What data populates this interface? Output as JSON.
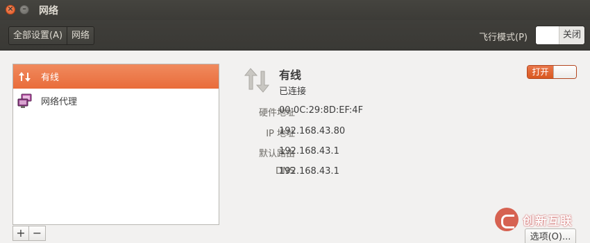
{
  "window": {
    "title": "网络"
  },
  "toolbar": {
    "breadcrumbs": [
      "全部设置(A)",
      "网络"
    ],
    "airplane_mode_label": "飞行模式(P)",
    "airplane_toggle_state": "关闭"
  },
  "sidebar": {
    "items": [
      {
        "label": "有线",
        "icon": "wired-network-icon",
        "selected": true
      },
      {
        "label": "网络代理",
        "icon": "network-proxy-icon",
        "selected": false
      }
    ],
    "add_label": "+",
    "remove_label": "−"
  },
  "detail": {
    "title": "有线",
    "status": "已连接",
    "toggle_state": "打开",
    "rows": [
      {
        "key": "硬件地址",
        "value": "00:0C:29:8D:EF:4F"
      },
      {
        "key": "IP 地址",
        "value": "192.168.43.80"
      },
      {
        "key": "默认路由",
        "value": "192.168.43.1"
      },
      {
        "key": "DNS",
        "value": "192.168.43.1"
      }
    ],
    "options_label": "选项(O)..."
  },
  "watermark": {
    "text": "创新互联"
  },
  "colors": {
    "accent": "#e96c3a",
    "titlebar": "#3c3b37"
  }
}
